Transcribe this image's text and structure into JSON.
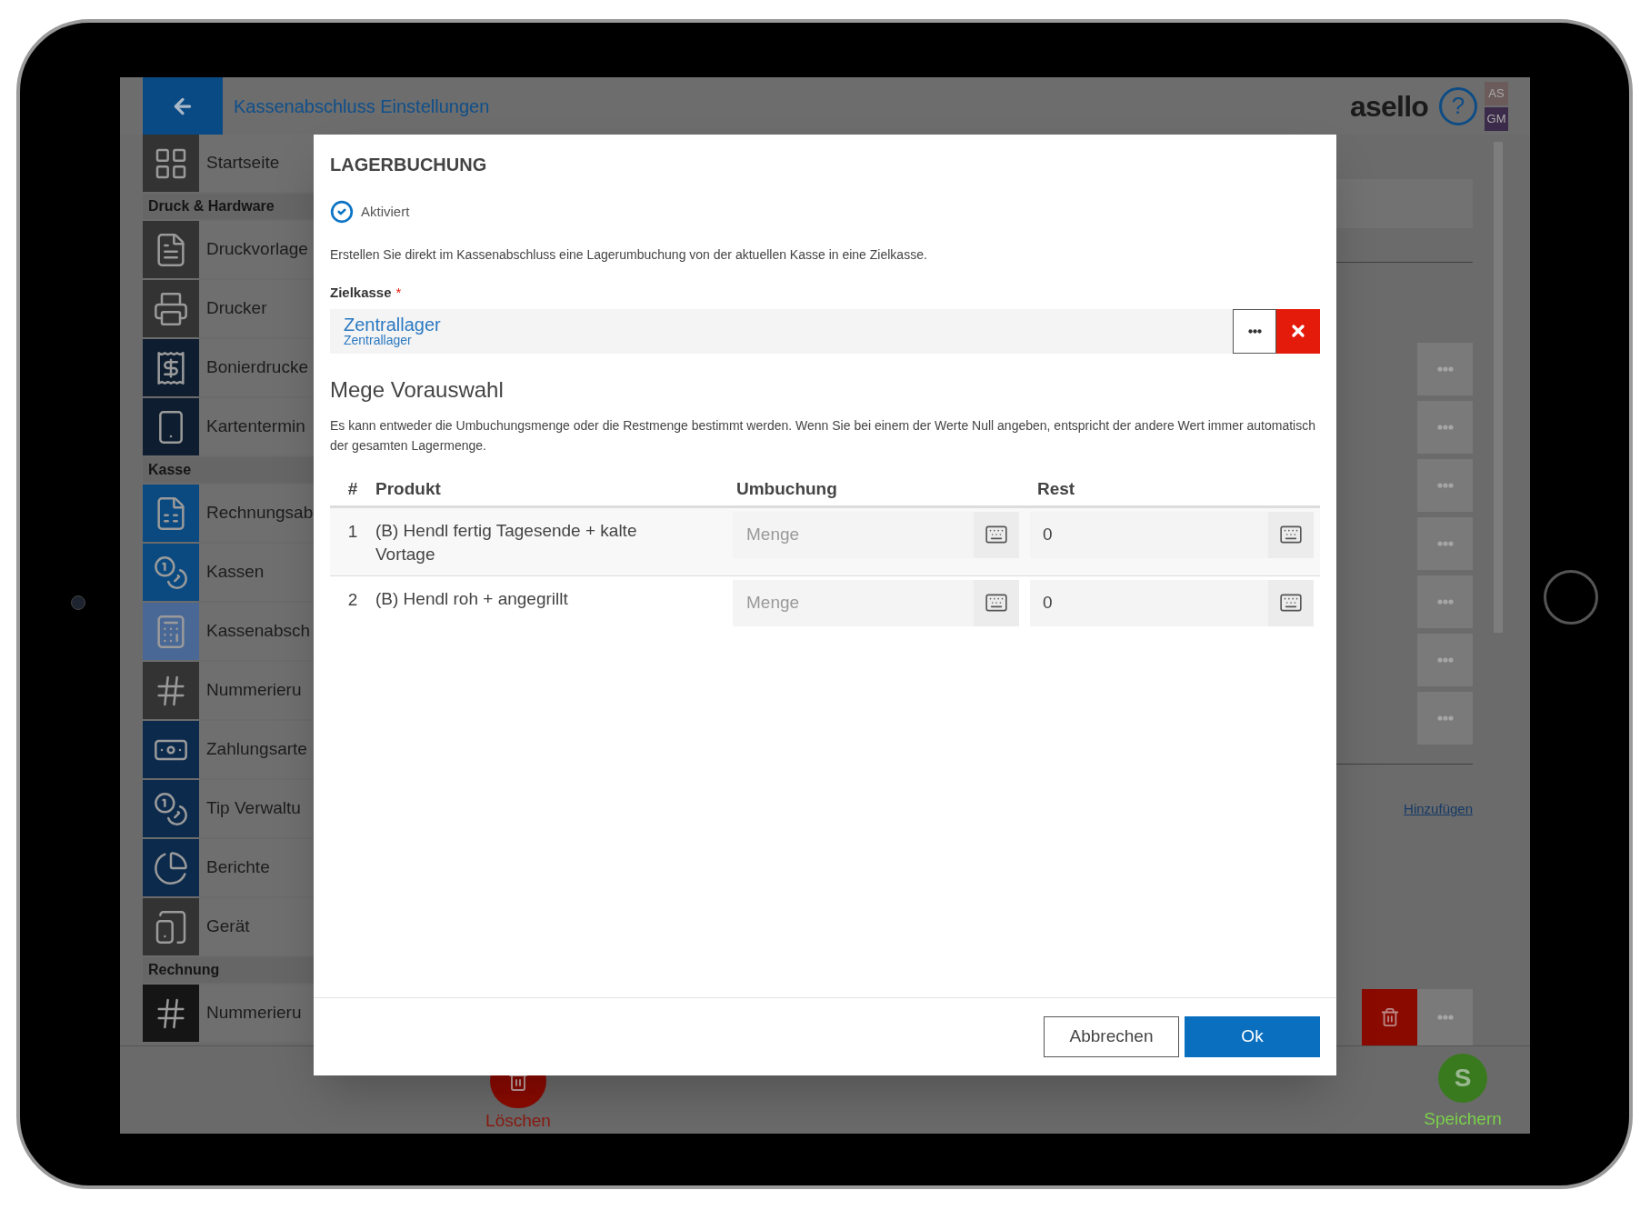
{
  "header": {
    "title": "Kassenabschluss Einstellungen",
    "logo": "asello",
    "help": "?",
    "users": [
      {
        "initials": "AS",
        "color": "#6b5b5b"
      },
      {
        "initials": "GM",
        "color": "#3b2a4a"
      }
    ]
  },
  "sidebar": {
    "items": [
      {
        "kind": "item",
        "label": "Startseite",
        "color": "#333333"
      },
      {
        "kind": "section",
        "label": "Druck & Hardware"
      },
      {
        "kind": "item",
        "label": "Druckvorlage",
        "color": "#333333"
      },
      {
        "kind": "item",
        "label": "Drucker",
        "color": "#333333"
      },
      {
        "kind": "item",
        "label": "Bonierdrucke",
        "color": "#0e1e30"
      },
      {
        "kind": "item",
        "label": "Kartentermin",
        "color": "#0e1e30"
      },
      {
        "kind": "section",
        "label": "Kasse"
      },
      {
        "kind": "item",
        "label": "Rechnungsab",
        "color": "#0b4a80"
      },
      {
        "kind": "item",
        "label": "Kassen",
        "color": "#0b4a80"
      },
      {
        "kind": "item",
        "label": "Kassenabsch",
        "color": "#4a6895"
      },
      {
        "kind": "item",
        "label": "Nummerieru",
        "color": "#333333"
      },
      {
        "kind": "item",
        "label": "Zahlungsarte",
        "color": "#0c2a4c"
      },
      {
        "kind": "item",
        "label": "Tip Verwaltu",
        "color": "#0c2a4c"
      },
      {
        "kind": "item",
        "label": "Berichte",
        "color": "#0c2a4c"
      },
      {
        "kind": "item",
        "label": "Gerät",
        "color": "#333333"
      },
      {
        "kind": "section",
        "label": "Rechnung"
      },
      {
        "kind": "item",
        "label": "Nummerieru",
        "color": "#151515"
      }
    ]
  },
  "main": {
    "rows": [
      {
        "kind": "entry"
      },
      {
        "kind": "entry"
      },
      {
        "kind": "entry"
      },
      {
        "kind": "entry"
      },
      {
        "kind": "entry"
      },
      {
        "kind": "entry"
      },
      {
        "kind": "entry"
      }
    ],
    "add_link": "Hinzufügen"
  },
  "bottom_bar": {
    "delete_label": "Löschen",
    "save_initial": "S",
    "save_label": "Speichern"
  },
  "dialog": {
    "title": "LAGERBUCHUNG",
    "activated": {
      "label": "Aktiviert",
      "checked": true
    },
    "description": "Erstellen Sie direkt im Kassenabschluss eine Lagerumbuchung von der aktuellen Kasse in eine Zielkasse.",
    "target": {
      "label": "Zielkasse",
      "required_mark": "*",
      "value": "Zentrallager",
      "subvalue": "Zentrallager"
    },
    "section_title": "Mege Vorauswahl",
    "section_text": "Es kann entweder die Umbuchungsmenge oder die Restmenge bestimmt werden. Wenn Sie bei einem der Werte Null angeben, entspricht der andere Wert immer automatisch der gesamten Lagermenge.",
    "table": {
      "columns": [
        "#",
        "Produkt",
        "Umbuchung",
        "Rest"
      ],
      "rows": [
        {
          "index": "1",
          "product": "(B) Hendl fertig Tagesende + kalte Vortage",
          "transfer_placeholder": "Menge",
          "rest": "0"
        },
        {
          "index": "2",
          "product": "(B) Hendl roh + angegrillt",
          "transfer_placeholder": "Menge",
          "rest": "0"
        }
      ]
    },
    "buttons": [
      {
        "label": "Abbrechen",
        "kind": "secondary"
      },
      {
        "label": "Ok",
        "kind": "primary"
      }
    ]
  }
}
